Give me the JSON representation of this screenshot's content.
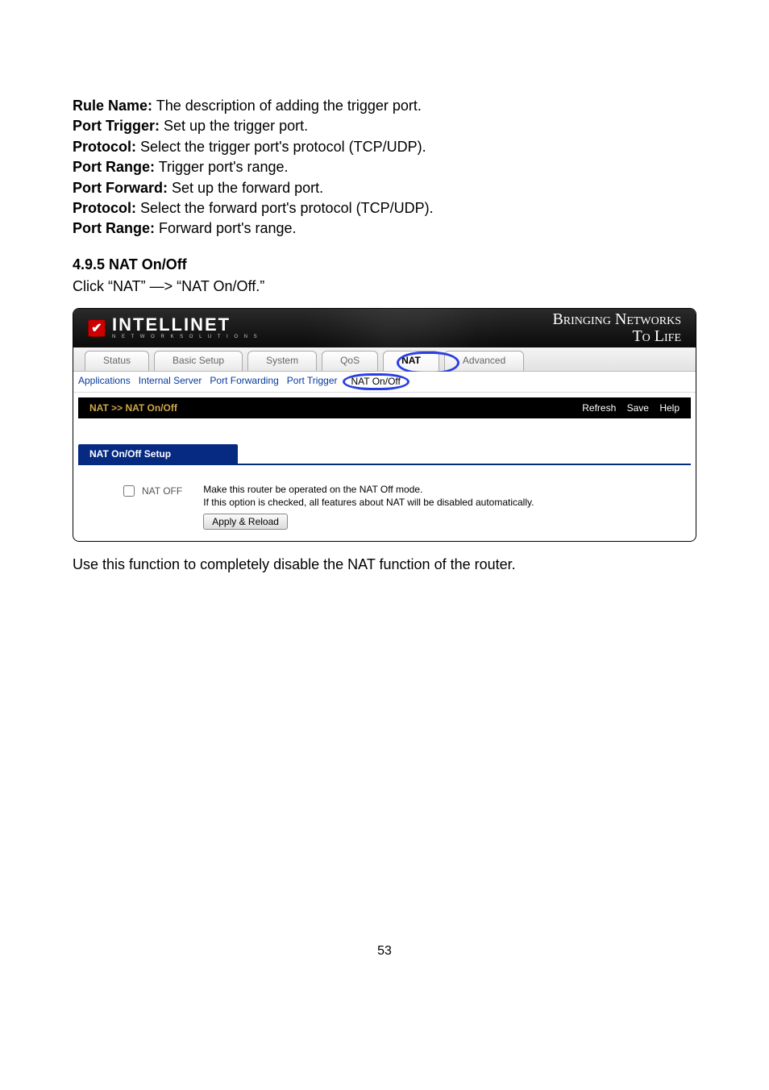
{
  "defs": {
    "rule_name": {
      "label": "Rule Name:",
      "text": "The description of adding the trigger port."
    },
    "port_trigger": {
      "label": "Port Trigger:",
      "text": "Set up the trigger port."
    },
    "protocol1": {
      "label": "Protocol:",
      "text": "Select the trigger port's protocol (TCP/UDP)."
    },
    "port_range1": {
      "label": "Port Range:",
      "text": "Trigger port's range."
    },
    "port_forward": {
      "label": "Port Forward:",
      "text": "Set up the forward port."
    },
    "protocol2": {
      "label": "Protocol:",
      "text": "Select the forward port's protocol (TCP/UDP)."
    },
    "port_range2": {
      "label": "Port Range:",
      "text": "Forward port's range."
    }
  },
  "section": {
    "title": "4.9.5 NAT On/Off",
    "instruction": "Click “NAT” —> “NAT On/Off.”"
  },
  "brand": {
    "name": "INTELLINET",
    "sub": "N E T W O R K   S O L U T I O N S",
    "tagline1": "Bringing Networks",
    "tagline2": "To Life"
  },
  "tabs": {
    "status": "Status",
    "basic": "Basic Setup",
    "system": "System",
    "qos": "QoS",
    "nat": "NAT",
    "advanced": "Advanced"
  },
  "subtabs": {
    "applications": "Applications",
    "internal": "Internal Server",
    "portfwd": "Port Forwarding",
    "porttrig": "Port Trigger",
    "natonoff": "NAT On/Off"
  },
  "pathbar": {
    "crumb": "NAT >> NAT On/Off",
    "refresh": "Refresh",
    "save": "Save",
    "help": "Help"
  },
  "panel": {
    "title": "NAT On/Off Setup",
    "checkbox_label": "NAT OFF",
    "line1": "Make this router be operated on the NAT Off mode.",
    "line2": "If this option is checked, all features about NAT will be disabled automatically.",
    "button": "Apply & Reload"
  },
  "after": "Use this function to completely disable the NAT function of the router.",
  "page_number": "53"
}
